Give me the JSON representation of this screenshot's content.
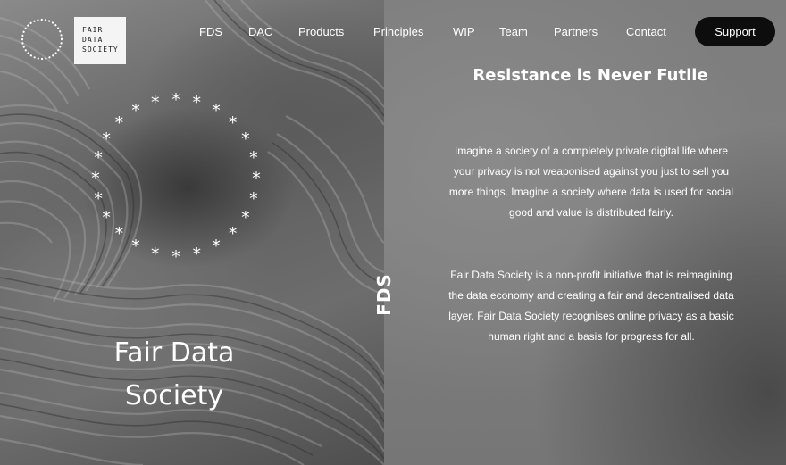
{
  "logo": {
    "lines": [
      "FAIR",
      "DATA",
      "SOCIETY"
    ]
  },
  "nav": {
    "items": [
      {
        "label": "FDS"
      },
      {
        "label": "DAC"
      },
      {
        "label": "Products"
      },
      {
        "label": "Principles"
      },
      {
        "label": "WIP"
      },
      {
        "label": "Team"
      },
      {
        "label": "Partners"
      },
      {
        "label": "Contact"
      }
    ],
    "support_label": "Support"
  },
  "hero": {
    "title_line1": "Fair Data",
    "title_line2": "Society",
    "vertical_label": "FDS"
  },
  "content": {
    "headline": "Resistance is Never Futile",
    "paragraph1": "Imagine a society of a completely private digital  life where your privacy is not weaponised against  you just to sell you more things. Imagine a society where data is used for social good and value is distributed fairly.",
    "paragraph2": "Fair Data Society is a non-profit initiative that is reimagining the data economy and creating a fair and decentralised data layer. Fair Data Society recognises online privacy as a  basic human right and a basis for progress for all."
  },
  "colors": {
    "support_button_bg": "#0d0d0d",
    "logo_box_bg": "#f4f4f4",
    "text": "#ffffff"
  }
}
